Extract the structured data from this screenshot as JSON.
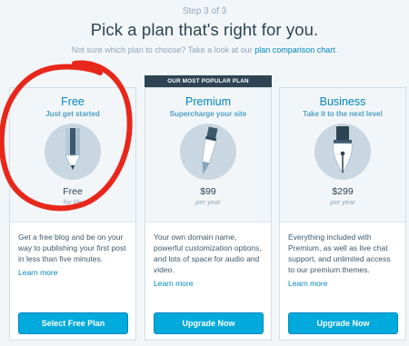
{
  "header": {
    "step": "Step 3 of 3",
    "title": "Pick a plan that's right for you.",
    "subtitle_prefix": "Not sure which plan to choose? Take a look at our ",
    "subtitle_link": "plan comparison chart",
    "subtitle_suffix": "."
  },
  "plans": [
    {
      "name": "Free",
      "tagline": "Just get started",
      "icon": "pencil-icon",
      "price": "Free",
      "period": "for life",
      "description": "Get a free blog and be on your way to publishing your first post in less than five minutes.",
      "learn_more": "Learn more",
      "button": "Select Free Plan"
    },
    {
      "name": "Premium",
      "badge": "OUR MOST POPULAR PLAN",
      "tagline": "Supercharge your site",
      "icon": "paintbrush-icon",
      "price": "$99",
      "period": "per year",
      "description": "Your own domain name, powerful customization options, and lots of space for audio and video.",
      "learn_more": "Learn more",
      "button": "Upgrade Now"
    },
    {
      "name": "Business",
      "tagline": "Take it to the next level",
      "icon": "fountain-pen-icon",
      "price": "$299",
      "period": "per year",
      "description": "Everything included with Premium, as well as live chat support, and unlimited access to our premium themes.",
      "learn_more": "Learn more",
      "button": "Upgrade Now"
    }
  ],
  "colors": {
    "accent": "#0087be",
    "button": "#00aadc",
    "badge_bg": "#2e4453",
    "annotation": "#e8271b"
  }
}
